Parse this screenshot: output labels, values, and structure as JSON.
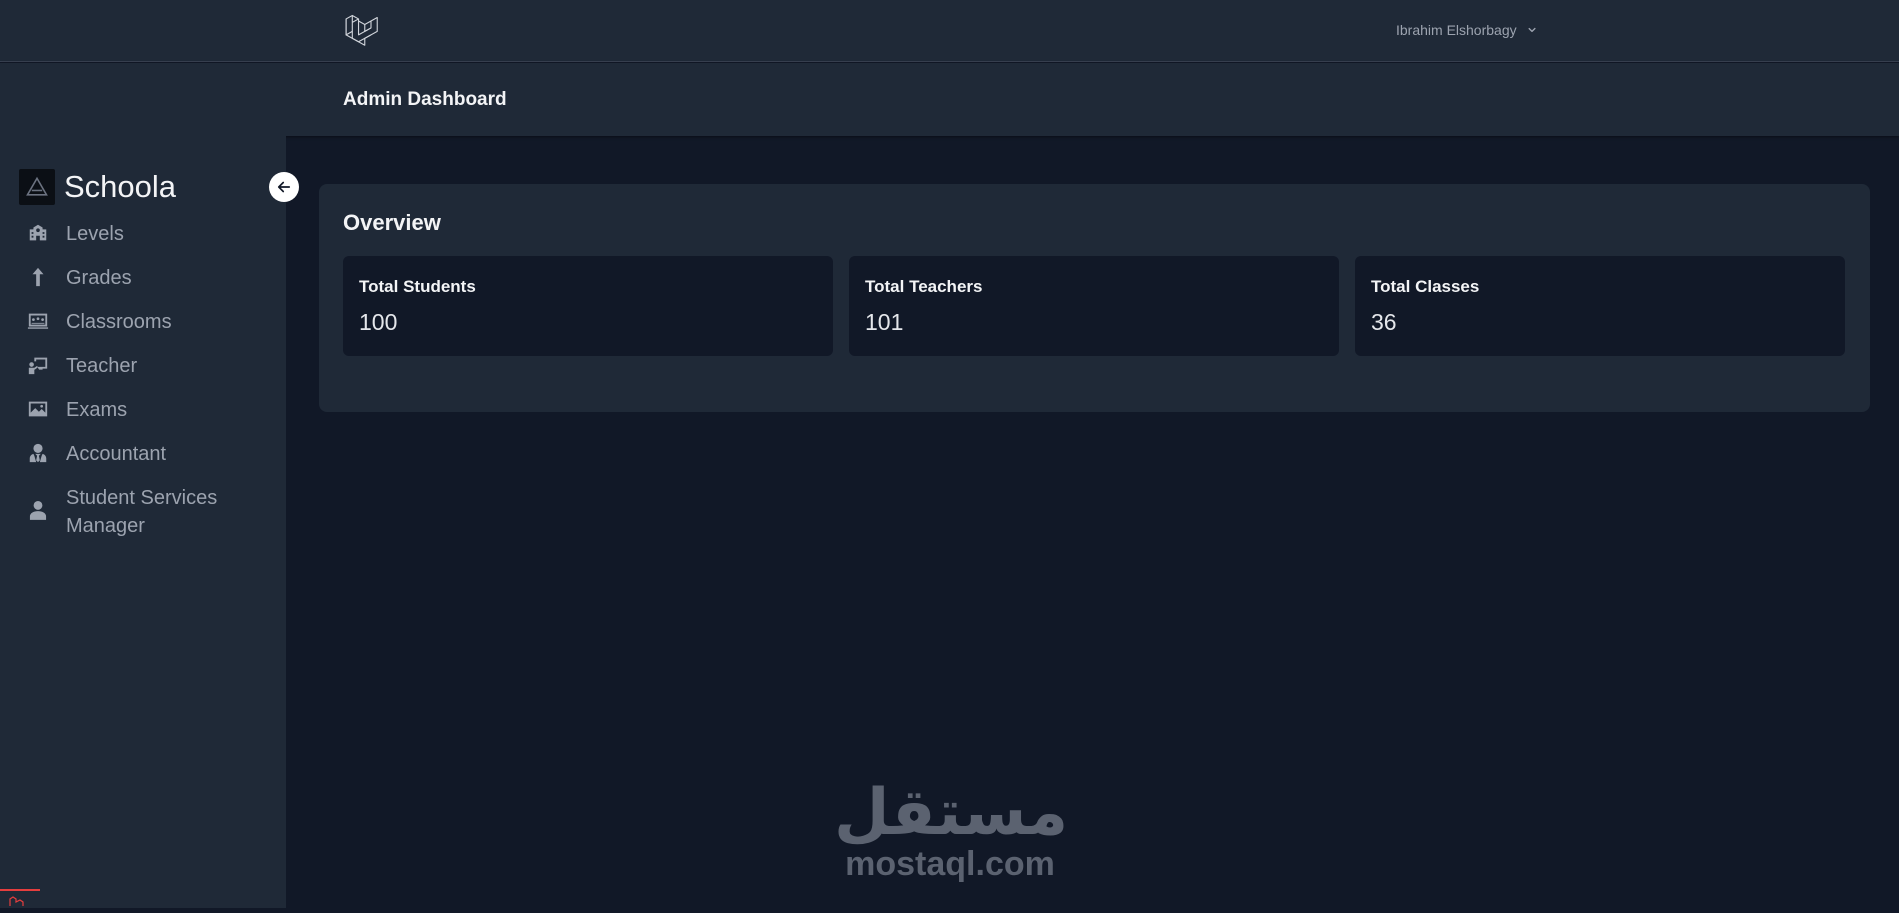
{
  "topnav": {
    "user_name": "Ibrahim Elshorbagy",
    "logo_icon": "laravel-logo-icon"
  },
  "header": {
    "title": "Admin Dashboard"
  },
  "sidebar": {
    "brand_name": "Schoola",
    "items": [
      {
        "label": "Levels",
        "icon": "school-icon"
      },
      {
        "label": "Grades",
        "icon": "arrow-up-icon"
      },
      {
        "label": "Classrooms",
        "icon": "classroom-icon"
      },
      {
        "label": "Teacher",
        "icon": "teacher-icon"
      },
      {
        "label": "Exams",
        "icon": "image-icon"
      },
      {
        "label": "Accountant",
        "icon": "user-tie-icon"
      },
      {
        "label": "Student Services Manager",
        "icon": "user-shield-icon"
      }
    ]
  },
  "overview": {
    "title": "Overview",
    "stats": [
      {
        "label": "Total Students",
        "value": "100"
      },
      {
        "label": "Total Teachers",
        "value": "101"
      },
      {
        "label": "Total Classes",
        "value": "36"
      }
    ]
  },
  "watermark": {
    "arabic": "مستقل",
    "latin": "mostaql.com"
  },
  "colors": {
    "background": "#111827",
    "surface": "#1f2937",
    "text": "#f3f4f6",
    "muted": "#9ca3af"
  }
}
